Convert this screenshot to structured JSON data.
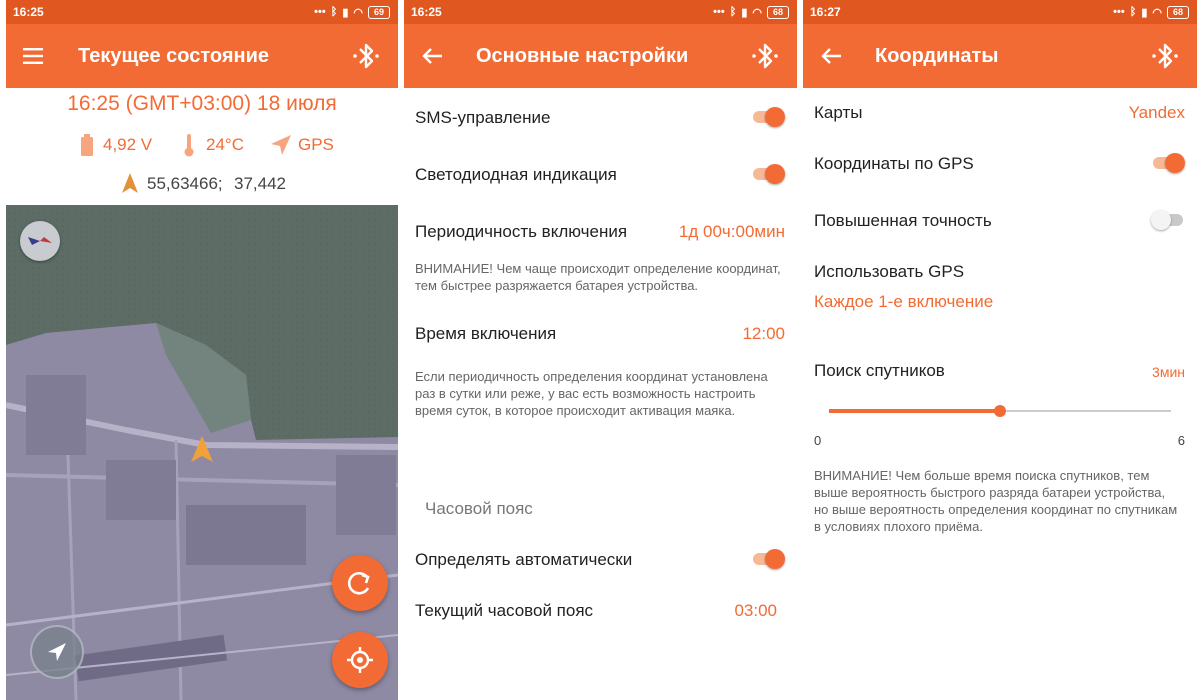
{
  "screens": [
    {
      "status": {
        "time": "16:25",
        "battery": "69"
      },
      "title": "Текущее состояние",
      "datetime": "16:25 (GMT+03:00) 18 июля",
      "voltage": "4,92 V",
      "temperature": "24°C",
      "source": "GPS",
      "lat": "55,63466;",
      "lon": "37,442",
      "icons": [
        "menu-icon",
        "bluetooth-icon",
        "battery-icon",
        "thermometer-icon",
        "gps-arrow-icon",
        "location-arrow-icon",
        "compass-icon",
        "refresh-icon",
        "locate-icon",
        "navigate-icon"
      ]
    },
    {
      "status": {
        "time": "16:25",
        "battery": "68"
      },
      "title": "Основные настройки",
      "sms_label": "SMS-управление",
      "sms_on": true,
      "led_label": "Светодиодная индикация",
      "led_on": true,
      "period_label": "Периодичность включения",
      "period_value": "1д 00ч:00мин",
      "period_note": "ВНИМАНИЕ! Чем чаще происходит определение координат, тем быстрее разряжается батарея устройства.",
      "time_label": "Время включения",
      "time_value": "12:00",
      "time_note": "Если периодичность определения координат установлена раз в сутки или реже, у вас есть возможность настроить время суток, в которое происходит активация маяка.",
      "tz_section": "Часовой пояс",
      "auto_label": "Определять автоматически",
      "auto_on": true,
      "tz_label": "Текущий часовой пояс",
      "tz_value": "03:00"
    },
    {
      "status": {
        "time": "16:27",
        "battery": "68"
      },
      "title": "Координаты",
      "maps_label": "Карты",
      "maps_value": "Yandex",
      "gps_label": "Координаты по GPS",
      "gps_on": true,
      "precision_label": "Повышенная точность",
      "precision_on": false,
      "use_gps_label": "Использовать GPS",
      "use_gps_value": "Каждое 1-е включение",
      "search_label": "Поиск спутников",
      "search_value": "3мин",
      "slider_min": "0",
      "slider_max": "6",
      "slider_current": 3,
      "search_note": "ВНИМАНИЕ! Чем больше время поиска спутников, тем выше вероятность быстрого разряда батареи устройства, но выше вероятность определения координат по спутникам в условиях плохого приёма."
    }
  ],
  "colors": {
    "accent": "#f36b34",
    "statusbar": "#e0581f",
    "toggle_track_on": "#f7b896",
    "map_water": "#5d6d66",
    "map_land": "#8e8aa4"
  }
}
